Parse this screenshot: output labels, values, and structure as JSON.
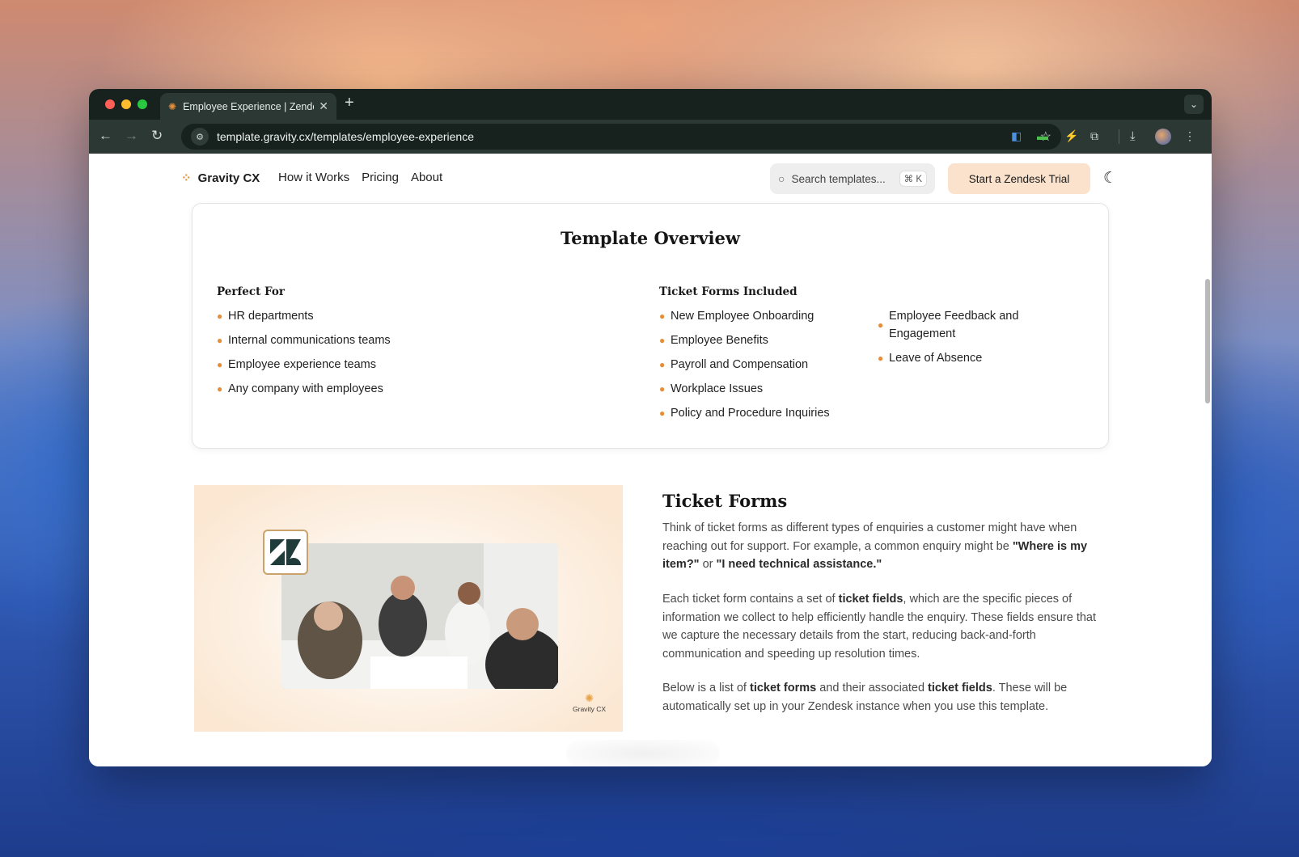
{
  "browser": {
    "tab_title": "Employee Experience | Zende",
    "new_tab_label": "+",
    "url": "template.gravity.cx/templates/employee-experience"
  },
  "site": {
    "brand": "Gravity CX",
    "nav": [
      "How it Works",
      "Pricing",
      "About"
    ],
    "search_placeholder": "Search templates...",
    "search_shortcut": "⌘ K",
    "cta_label": "Start a Zendesk Trial"
  },
  "overview": {
    "title": "Template Overview",
    "perfect_for_heading": "Perfect For",
    "perfect_for": [
      "HR departments",
      "Internal communications teams",
      "Employee experience teams",
      "Any company with employees"
    ],
    "forms_heading": "Ticket Forms Included",
    "forms_col1": [
      "New Employee Onboarding",
      "Employee Benefits",
      "Payroll and Compensation",
      "Workplace Issues",
      "Policy and Procedure Inquiries"
    ],
    "forms_col2": [
      "Employee Feedback and Engagement",
      "Leave of Absence"
    ]
  },
  "ticket_forms": {
    "title": "Ticket Forms",
    "p1_a": "Think of ticket forms as different types of enquiries a customer might have when reaching out for support. For example, a common enquiry might be ",
    "p1_b": "\"Where is my item?\"",
    "p1_c": " or ",
    "p1_d": "\"I need technical assistance.\"",
    "p2_a": "Each ticket form contains a set of ",
    "p2_b": "ticket fields",
    "p2_c": ", which are the specific pieces of information we collect to help efficiently handle the enquiry. These fields ensure that we capture the necessary details from the start, reducing back-and-forth communication and speeding up resolution times.",
    "p3_a": "Below is a list of ",
    "p3_b": "ticket forms",
    "p3_c": " and their associated ",
    "p3_d": "ticket fields",
    "p3_e": ". These will be automatically set up in your Zendesk instance when you use this template.",
    "image_watermark": "Gravity CX"
  },
  "colors": {
    "accent": "#e58e3a",
    "cta_bg": "#fbe2cc",
    "browser_dark": "#17221f"
  }
}
